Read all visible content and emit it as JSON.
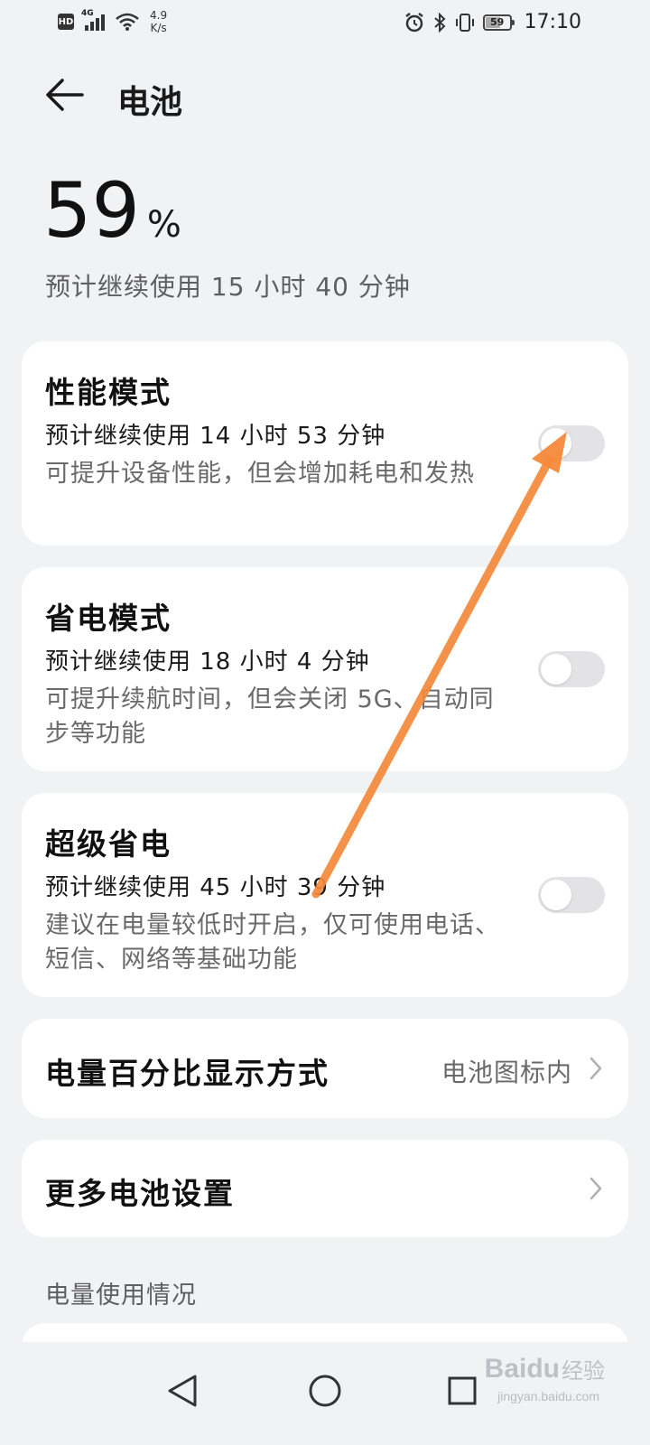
{
  "status_bar": {
    "hd_label": "HD",
    "network_label": "4G",
    "speed_value": "4.9",
    "speed_unit": "K/s",
    "battery_level": "59",
    "time": "17:10"
  },
  "header": {
    "title": "电池"
  },
  "summary": {
    "percent": "59",
    "percent_sign": "%",
    "estimate": "预计继续使用 15 小时 40 分钟"
  },
  "modes": [
    {
      "title": "性能模式",
      "estimate": "预计继续使用 14 小时 53 分钟",
      "description": "可提升设备性能，但会增加耗电和发热",
      "enabled": false
    },
    {
      "title": "省电模式",
      "estimate": "预计继续使用 18 小时 4 分钟",
      "description": "可提升续航时间，但会关闭 5G、自动同步等功能",
      "enabled": false
    },
    {
      "title": "超级省电",
      "estimate": "预计继续使用 45 小时 39 分钟",
      "description": "建议在电量较低时开启，仅可使用电话、短信、网络等基础功能",
      "enabled": false
    }
  ],
  "settings": {
    "percent_display_label": "电量百分比显示方式",
    "percent_display_value": "电池图标内",
    "more_settings_label": "更多电池设置"
  },
  "usage": {
    "section_title": "电量使用情况"
  },
  "watermark": {
    "logo": "Baidu",
    "text": "经验",
    "sub": "jingyan.baidu.com"
  },
  "colors": {
    "background": "#f1f2f4",
    "card": "#ffffff",
    "annotation_arrow": "#f5893a",
    "toggle_off": "#e3e3e6"
  }
}
